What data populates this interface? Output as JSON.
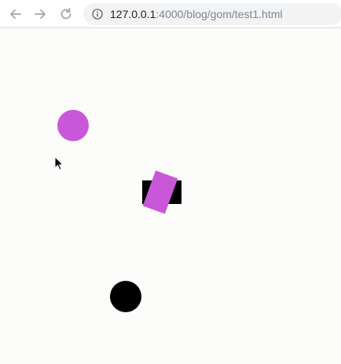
{
  "browser": {
    "url_host": "127.0.0.1",
    "url_rest": ":4000/blog/gom/test1.html",
    "icons": {
      "back": "back-arrow-icon",
      "forward": "forward-arrow-icon",
      "reload": "reload-icon",
      "info": "info-icon"
    }
  },
  "canvas": {
    "shapes": [
      {
        "kind": "circle",
        "color": "#c858d8"
      },
      {
        "kind": "rectangle",
        "color": "#000000"
      },
      {
        "kind": "rotated-rectangle",
        "color": "#c858d8"
      },
      {
        "kind": "circle",
        "color": "#000000"
      }
    ]
  },
  "colors": {
    "magenta": "#c858d8",
    "black": "#000000",
    "background": "#fcfcfb",
    "url_muted": "#80868b"
  }
}
